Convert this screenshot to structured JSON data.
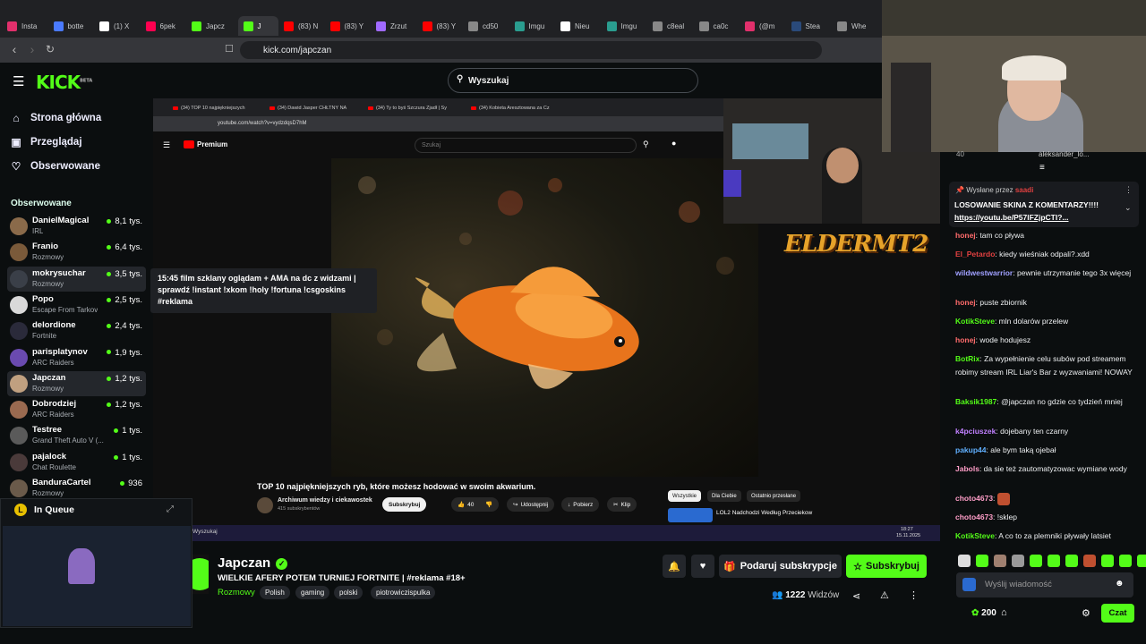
{
  "browser": {
    "tabs": [
      "Insta",
      "botte",
      "(1) X",
      "6pek",
      "Japcz",
      "J",
      "(83) N",
      "(83) Y",
      "Zrzut",
      "(83) Y",
      "cd50",
      "Imgu",
      "Nieu",
      "Imgu",
      "c8eal",
      "ca0c",
      "(@m",
      "Stea",
      "Whe"
    ],
    "url": "kick.com/japczan"
  },
  "kick": {
    "logo": "KICK",
    "logo_badge": "BETA",
    "search_placeholder": "Wyszukaj",
    "nav": [
      {
        "label": "Strona główna",
        "icon": "home-icon"
      },
      {
        "label": "Przeglądaj",
        "icon": "browse-icon"
      },
      {
        "label": "Obserwowane",
        "icon": "heart-icon"
      }
    ],
    "following_header": "Obserwowane",
    "channels": [
      {
        "name": "DanielMagical",
        "category": "IRL",
        "viewers": "8,1 tys.",
        "color": "#8a6a4a"
      },
      {
        "name": "Franio",
        "category": "Rozmowy",
        "viewers": "6,4 tys.",
        "color": "#7a5a3a"
      },
      {
        "name": "mokrysuchar",
        "category": "Rozmowy",
        "viewers": "3,5 tys.",
        "color": "#3a3f48"
      },
      {
        "name": "Popo",
        "category": "Escape From Tarkov",
        "viewers": "2,5 tys.",
        "color": "#d9d9d9"
      },
      {
        "name": "delordione",
        "category": "Fortnite",
        "viewers": "2,4 tys.",
        "color": "#2a2a3a"
      },
      {
        "name": "parisplatynov",
        "category": "ARC Raiders",
        "viewers": "1,9 tys.",
        "color": "#6a4ab0"
      },
      {
        "name": "Japczan",
        "category": "Rozmowy",
        "viewers": "1,2 tys.",
        "color": "#c0a080"
      },
      {
        "name": "Dobrodziej",
        "category": "ARC Raiders",
        "viewers": "1,2 tys.",
        "color": "#9a6a50"
      },
      {
        "name": "Testree",
        "category": "Grand Theft Auto V (...",
        "viewers": "1 tys.",
        "color": "#5a5a5a"
      },
      {
        "name": "pajalock",
        "category": "Chat Roulette",
        "viewers": "1 tys.",
        "color": "#4a3a3a"
      },
      {
        "name": "BanduraCartel",
        "category": "Rozmowy",
        "viewers": "936",
        "color": "#6a5a4a"
      }
    ],
    "tooltip": "15:45 film szklany oglądam + AMA na dc z widzami | sprawdź !instant !xkom !holy !fortuna !csgoskins #reklama",
    "mini_player_label": "In Queue"
  },
  "embedded": {
    "tabs": [
      "(34) TOP 10 najpiękniejszych",
      "(34) Dawid Jasper CHŁTNY NA",
      "(34) Ty to byś Szczura Zjadł | Sy",
      "(34) Kobieta Aresztowana za Cz"
    ],
    "url": "youtube.com/watch?v=vydzdqsD7hM",
    "yt_logo": "Premium",
    "yt_search": "Szukaj",
    "video_title": "TOP 10 najpiękniejszych ryb, które możesz hodować w swoim akwarium.",
    "channel": "Archiwum wiedzy i ciekawostek",
    "channel_subs": "415 subskrybentów",
    "subscribe": "Subskrybuj",
    "likes": "40",
    "share": "Udostępnij",
    "download": "Pobierz",
    "clip": "Klip",
    "chips": [
      "Wszystkie",
      "Dla Ciebie",
      "Ostatnio przesłane"
    ],
    "rec_title": "LOL2 Nadchodzi Według Przeciekow",
    "overlay_game": "ELDERMT2",
    "taskbar_search": "Wyszukaj",
    "clock_time": "18:27",
    "clock_date": "15.11.2025"
  },
  "stream": {
    "name": "Japczan",
    "title": "WIELKIE AFERY POTEM TURNIEJ FORTNITE | #reklama #18+",
    "category": "Rozmowy",
    "tags": [
      "Polish",
      "gaming",
      "polski",
      "piotrowiczispulka"
    ],
    "gift_label": "Podaruj subskrypcje",
    "subscribe_label": "Subskrybuj",
    "viewers_count": "1222",
    "viewers_label": "Widzów"
  },
  "chat": {
    "top_user": "aleksander_lo...",
    "top_count": "40",
    "pinned_by_label": "Wysłane przez",
    "pinned_by_user": "saadi",
    "pinned_text": "LOSOWANIE SKINA Z KOMENTARZY!!!!",
    "pinned_link": "https://youtu.be/P57lFZjpCTI?...",
    "messages": [
      {
        "user": "honej",
        "text": "tam co pływa",
        "color": "#ff6b6b"
      },
      {
        "user": "El_Petardo",
        "text": "kiedy wieśniak odpali?.xdd",
        "color": "#e04040"
      },
      {
        "user": "wildwestwarrior",
        "text": "pewnie utrzymanie tego 3x więcej",
        "color": "#a0a0ff"
      },
      {
        "user": "honej",
        "text": "puste zbiornik",
        "color": "#ff6b6b"
      },
      {
        "user": "KotikSteve",
        "text": "mln dolarów przelew",
        "color": "#53fc18"
      },
      {
        "user": "honej",
        "text": "wode hodujesz",
        "color": "#ff6b6b"
      },
      {
        "user": "BotRix",
        "text": "Za wypełnienie celu subów pod streamem robimy stream IRL Liar's Bar z wyzwaniami! NOWAY",
        "color": "#53fc18"
      },
      {
        "user": "Baksik1987",
        "text": "@japczan no gdzie co tydzień mniej",
        "color": "#53fc18"
      },
      {
        "user": "k4pciuszek",
        "text": "dojebany ten czarny",
        "color": "#c080ff"
      },
      {
        "user": "pakup44",
        "text": "ale bym taką ojebał",
        "color": "#60b0ff"
      },
      {
        "user": "Jabols",
        "text": "da sie też zautomatyzowac wymiane wody",
        "color": "#ff9ec8"
      },
      {
        "user": "choto4673",
        "text": "",
        "color": "#ff9ec8"
      },
      {
        "user": "choto4673",
        "text": "!sklep",
        "color": "#ff9ec8"
      },
      {
        "user": "KotikSteve",
        "text": "A co to za plemniki pływały latsiet",
        "color": "#53fc18"
      }
    ],
    "input_placeholder": "Wyślij wiadomość",
    "points": "200",
    "send_label": "Czat"
  },
  "colors": {
    "accent": "#53fc18",
    "bg": "#0b0e0f",
    "panel": "#24272c"
  }
}
